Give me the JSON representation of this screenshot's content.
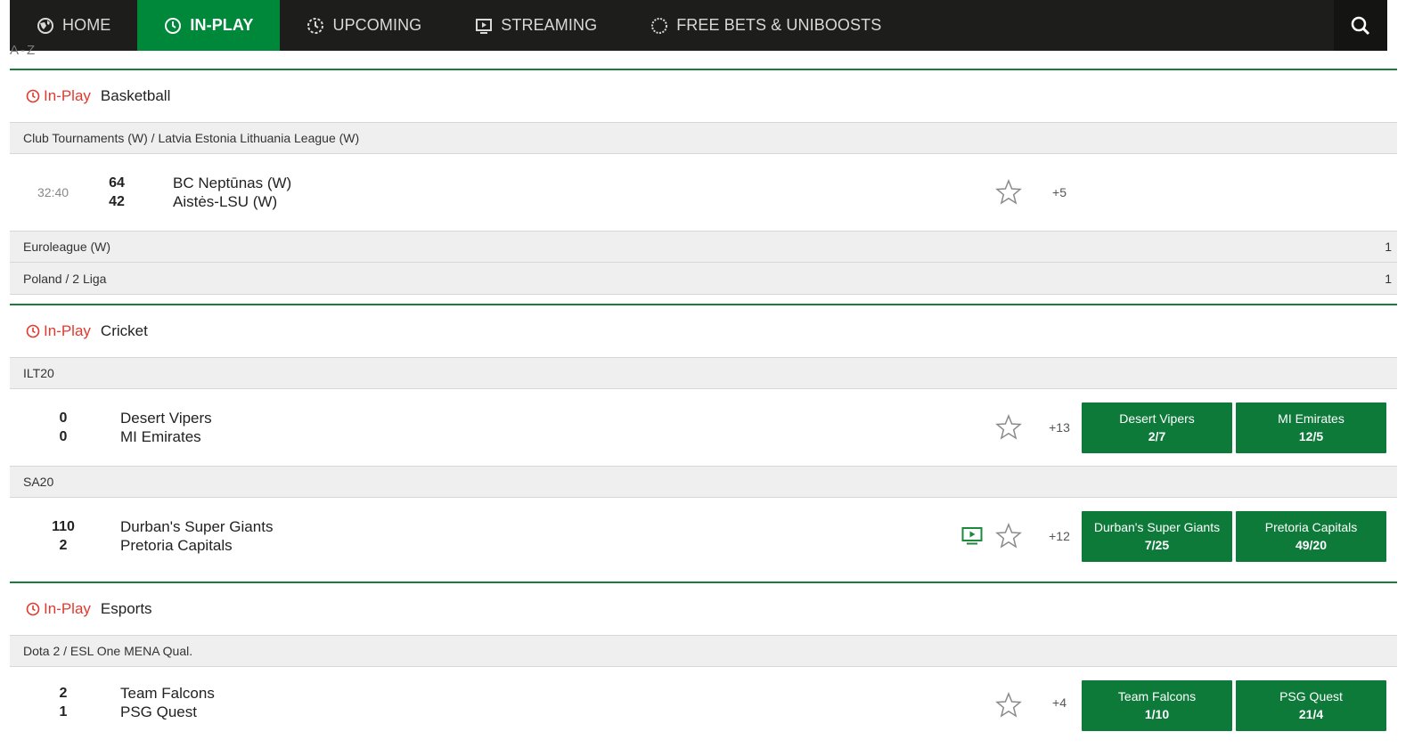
{
  "nav": {
    "items": [
      {
        "label": "HOME",
        "icon": "globe-icon"
      },
      {
        "label": "IN-PLAY",
        "icon": "clock-icon"
      },
      {
        "label": "UPCOMING",
        "icon": "upcoming-clock-icon"
      },
      {
        "label": "STREAMING",
        "icon": "tv-icon"
      },
      {
        "label": "FREE BETS & UNIBOOSTS",
        "icon": "circle-icon"
      }
    ],
    "active": "IN-PLAY",
    "search_icon": "search-icon"
  },
  "az_label": "A-Z",
  "colors": {
    "accent": "#00883a",
    "odds_button": "#0d7a3a",
    "inplay_red": "#e03a2f",
    "nav_bg": "#1d1d1b"
  },
  "sections": {
    "basketball": {
      "inplay_label": "In-Play",
      "sport": "Basketball",
      "competitions": [
        {
          "name": "Club Tournaments (W) / Latvia Estonia Lithuania League (W)"
        },
        {
          "name": "Euroleague (W)",
          "count": "1"
        },
        {
          "name": "Poland / 2 Liga",
          "count": "1"
        }
      ],
      "event": {
        "time": "32:40",
        "score_home": "64",
        "score_away": "42",
        "home": "BC Neptūnas (W)",
        "away": "Aistės-LSU (W)",
        "more": "+5"
      }
    },
    "cricket": {
      "inplay_label": "In-Play",
      "sport": "Cricket",
      "competitions": [
        {
          "name": "ILT20"
        },
        {
          "name": "SA20"
        }
      ],
      "events": [
        {
          "score_home": "0",
          "score_away": "0",
          "home": "Desert Vipers",
          "away": "MI Emirates",
          "more": "+13",
          "odds": [
            {
              "selection": "Desert Vipers",
              "price": "2/7"
            },
            {
              "selection": "MI Emirates",
              "price": "12/5"
            }
          ]
        },
        {
          "score_home": "110",
          "score_away": "2",
          "home": "Durban's Super Giants",
          "away": "Pretoria Capitals",
          "more": "+12",
          "odds": [
            {
              "selection": "Durban's Super Giants",
              "price": "7/25"
            },
            {
              "selection": "Pretoria Capitals",
              "price": "49/20"
            }
          ]
        }
      ]
    },
    "esports": {
      "inplay_label": "In-Play",
      "sport": "Esports",
      "competitions": [
        {
          "name": "Dota 2 / ESL One MENA Qual."
        }
      ],
      "event": {
        "score_home": "2",
        "score_away": "1",
        "home": "Team Falcons",
        "away": "PSG Quest",
        "more": "+4",
        "odds": [
          {
            "selection": "Team Falcons",
            "price": "1/10"
          },
          {
            "selection": "PSG Quest",
            "price": "21/4"
          }
        ]
      }
    }
  }
}
